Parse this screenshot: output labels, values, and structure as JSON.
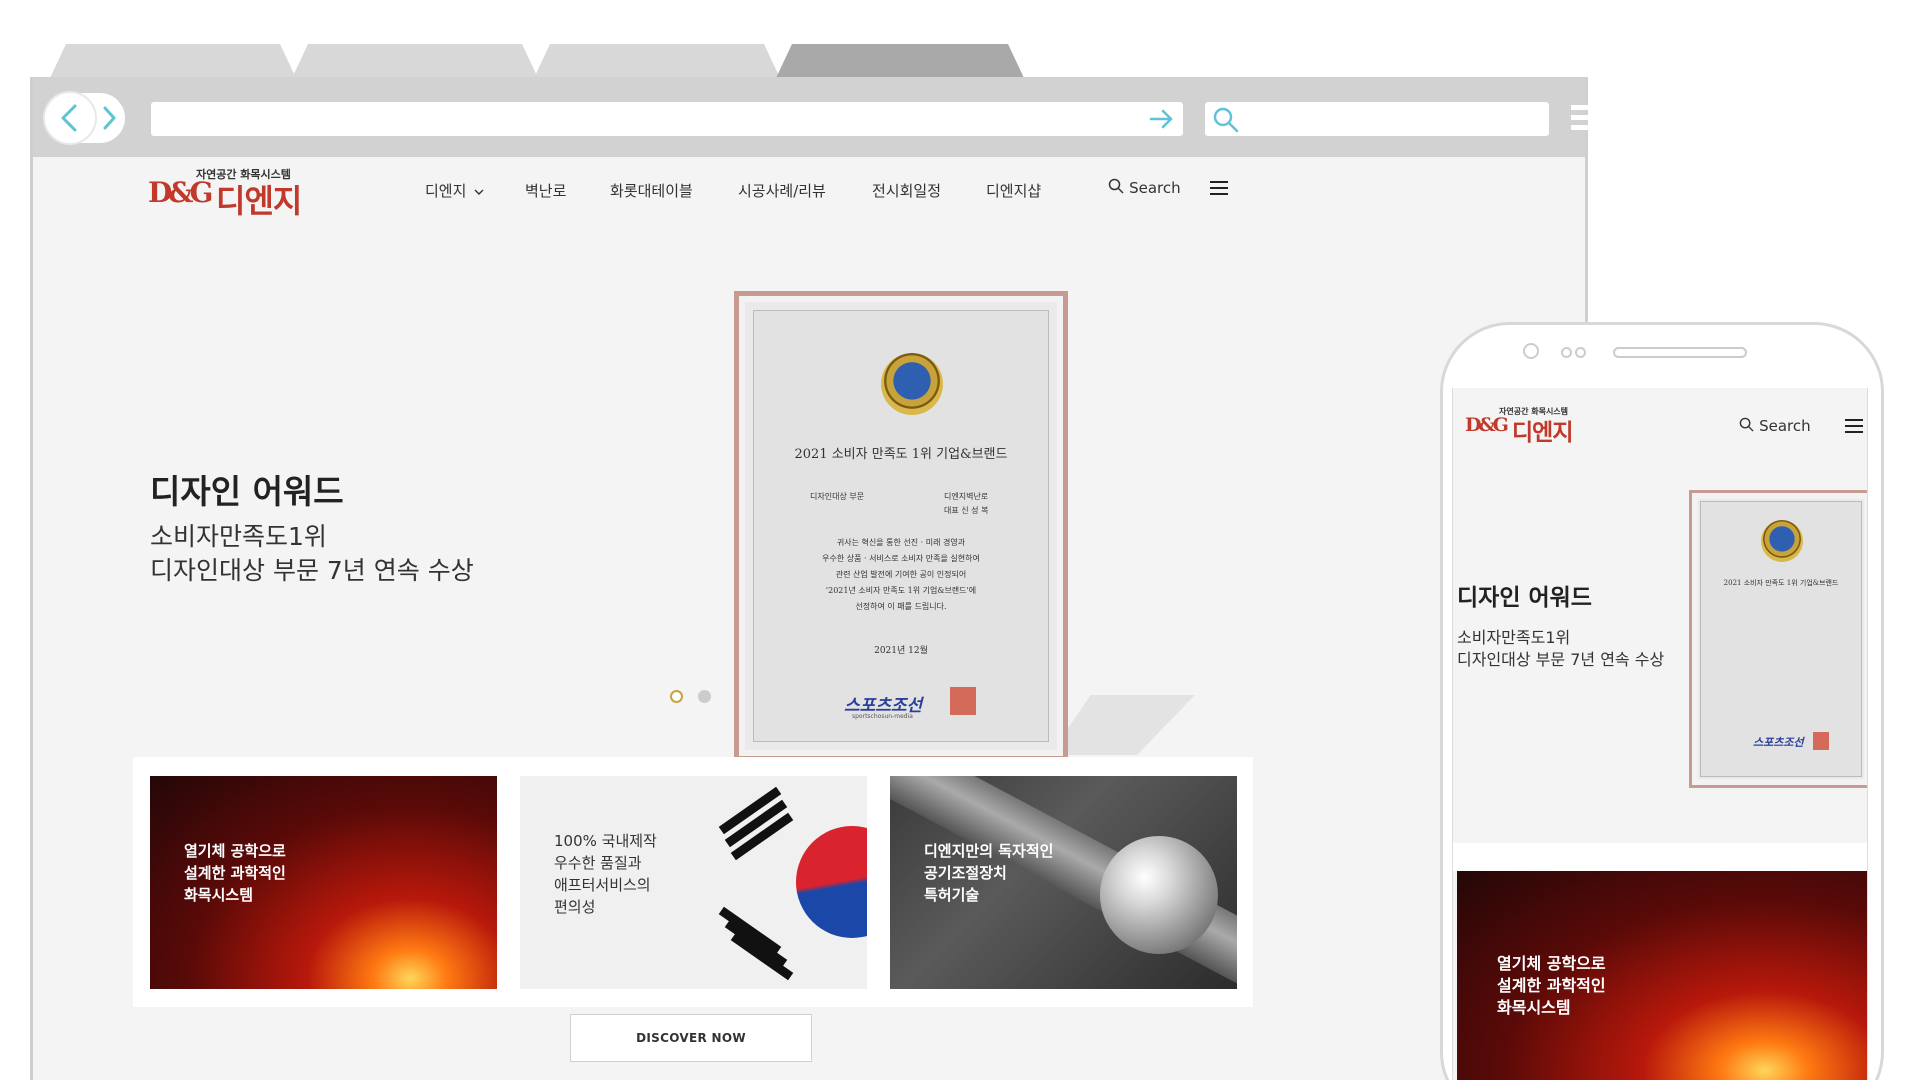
{
  "site": {
    "logo_tagline": "자연공간 화목시스템",
    "logo_brand": "디엔지",
    "logo_mark": "D&G"
  },
  "nav": {
    "items": [
      "디엔지",
      "벽난로",
      "화롯대테이블",
      "시공사례/리뷰",
      "전시회일정",
      "디엔지샵"
    ],
    "search_label": "Search"
  },
  "hero": {
    "title": "디자인 어워드",
    "subtitle_line1": "소비자만족도1위",
    "subtitle_line2": "디자인대상 부문 7년 연속 수상",
    "slides_total": 2,
    "slide_active": 1
  },
  "plaque": {
    "heading": "2021 소비자 만족도 1위 기업&브랜드",
    "left_label": "디자인대상 부문",
    "right_label_1": "디엔지벽난로",
    "right_label_2": "대표 신 성 복",
    "body": [
      "귀사는 혁신을 통한 선진 · 미래 경영과",
      "우수한 상품 · 서비스로 소비자 만족을 실현하여",
      "관련 산업 발전에 기여한 공이 인정되어",
      "'2021년 소비자 만족도 1위 기업&브랜드'에",
      "선정하여 이 패를 드립니다."
    ],
    "date": "2021년 12월",
    "issuer": "스포츠조선",
    "issuer_sub": "sportschosun-media"
  },
  "cards": [
    {
      "lines": [
        "열기체 공학으로",
        "설계한 과학적인",
        "화목시스템"
      ]
    },
    {
      "lines": [
        "100% 국내제작",
        "우수한 품질과",
        "애프터서비스의",
        "편의성"
      ]
    },
    {
      "lines": [
        "디엔지만의 독자적인",
        "공기조절장치",
        "특허기술"
      ]
    }
  ],
  "discover_label": "DISCOVER NOW",
  "colors": {
    "brand_red": "#c0392b",
    "dot_active": "#c8a23a",
    "dot_inactive": "#cccccc",
    "arrow_accent": "#5fc3d6"
  }
}
